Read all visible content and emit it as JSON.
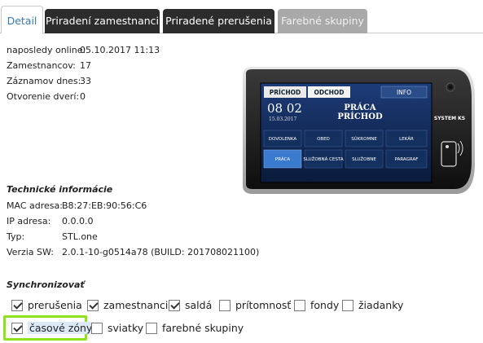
{
  "tabs": [
    {
      "label": "Detail"
    },
    {
      "label": "Priradení zamestnanci"
    },
    {
      "label": "Priradené prerušenia"
    },
    {
      "label": "Farebné skupiny"
    }
  ],
  "info": [
    {
      "key": "naposledy online:",
      "value": "05.10.2017 11:13"
    },
    {
      "key": "Zamestnancov:",
      "value": "17"
    },
    {
      "key": "Záznamov dnes:",
      "value": "33"
    },
    {
      "key": "Otvorenie dverí:",
      "value": "0"
    }
  ],
  "tech": {
    "title": "Technické informácie",
    "rows": [
      {
        "key": "MAC adresa:",
        "value": "B8:27:EB:90:56:C6"
      },
      {
        "key": "IP adresa:",
        "value": "0.0.0.0"
      },
      {
        "key": "Typ:",
        "value": "STL.one"
      },
      {
        "key": "Verzia SW:",
        "value": "2.0.1-10-g0514a78 (BUILD: 201708021100)"
      }
    ]
  },
  "sync": {
    "title": "Synchronizovať",
    "options": [
      {
        "label": "prerušenia",
        "checked": true
      },
      {
        "label": "zamestnanci",
        "checked": true
      },
      {
        "label": "saldá",
        "checked": true
      },
      {
        "label": "prítomnosť",
        "checked": false
      },
      {
        "label": "fondy",
        "checked": false
      },
      {
        "label": "žiadanky",
        "checked": false
      },
      {
        "label": "časové zóny",
        "checked": true
      },
      {
        "label": "sviatky",
        "checked": false
      },
      {
        "label": "farebné skupiny",
        "checked": false
      }
    ]
  },
  "device": {
    "btn_arrival": "PRÍCHOD",
    "btn_departure": "ODCHOD",
    "btn_info": "INFO",
    "time": "08 02",
    "date": "15.03.2017",
    "status_line1": "PRÁCA",
    "status_line2": "PRÍCHOD",
    "grid": [
      "DOVOLENKA",
      "OBED",
      "SÚKROMNE",
      "LEKÁR",
      "PRÁCA",
      "SLUŽOBNÁ CESTA",
      "SLUŽOBNE",
      "PARAGRAF"
    ],
    "brand": "SYSTEM KS"
  },
  "colors": {
    "accent_tab_text": "#3a78b5",
    "tab_dark": "#2c2c2c",
    "tab_disabled": "#a9a9a9",
    "highlight": "#8fe31d"
  }
}
